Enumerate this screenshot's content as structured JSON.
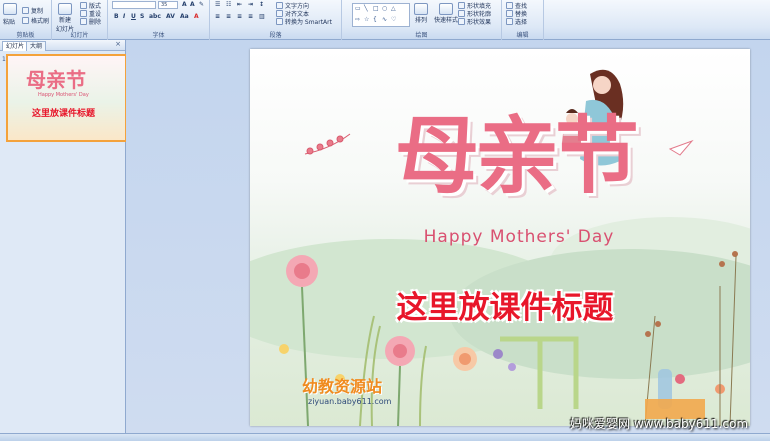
{
  "ribbon": {
    "groups": {
      "clipboard": "剪贴板",
      "slides": "幻灯片",
      "font": "字体",
      "paragraph": "段落",
      "drawing": "绘图",
      "editing": "编辑"
    },
    "clipboard": {
      "paste": "粘贴",
      "copy": "复制",
      "format_painter": "格式刷"
    },
    "slides": {
      "new_slide": "新建",
      "new_slide_2": "幻灯片",
      "layout": "版式",
      "reset": "重设",
      "delete": "删除"
    },
    "font": {
      "size_value": "35"
    },
    "paragraph": {
      "text_direction": "文字方向",
      "align_text": "对齐文本",
      "smartart": "转换为 SmartArt"
    },
    "drawing": {
      "arrange": "排列",
      "quick_styles": "快速样式",
      "shape_fill": "形状填充",
      "shape_outline": "形状轮廓",
      "shape_effects": "形状效果"
    },
    "editing": {
      "find": "查找",
      "replace": "替换",
      "select": "选择"
    }
  },
  "panel": {
    "tab_slides": "幻灯片",
    "tab_outline": "大纲",
    "thumb_number": "1",
    "thumb_title": "母亲节",
    "thumb_subtitle": "Happy Mothers' Day",
    "thumb_main": "这里放课件标题"
  },
  "slide": {
    "title_cn": "母亲节",
    "title_en": "Happy Mothers' Day",
    "main_title": "这里放课件标题",
    "logo_text": "幼教资源站",
    "logo_url": "ziyuan.baby611.com"
  },
  "watermark": "妈咪爱婴网 www.baby611.com",
  "colors": {
    "accent_pink": "#ea6d85",
    "title_red": "#e8162a",
    "thumb_border": "#f4a23b"
  }
}
